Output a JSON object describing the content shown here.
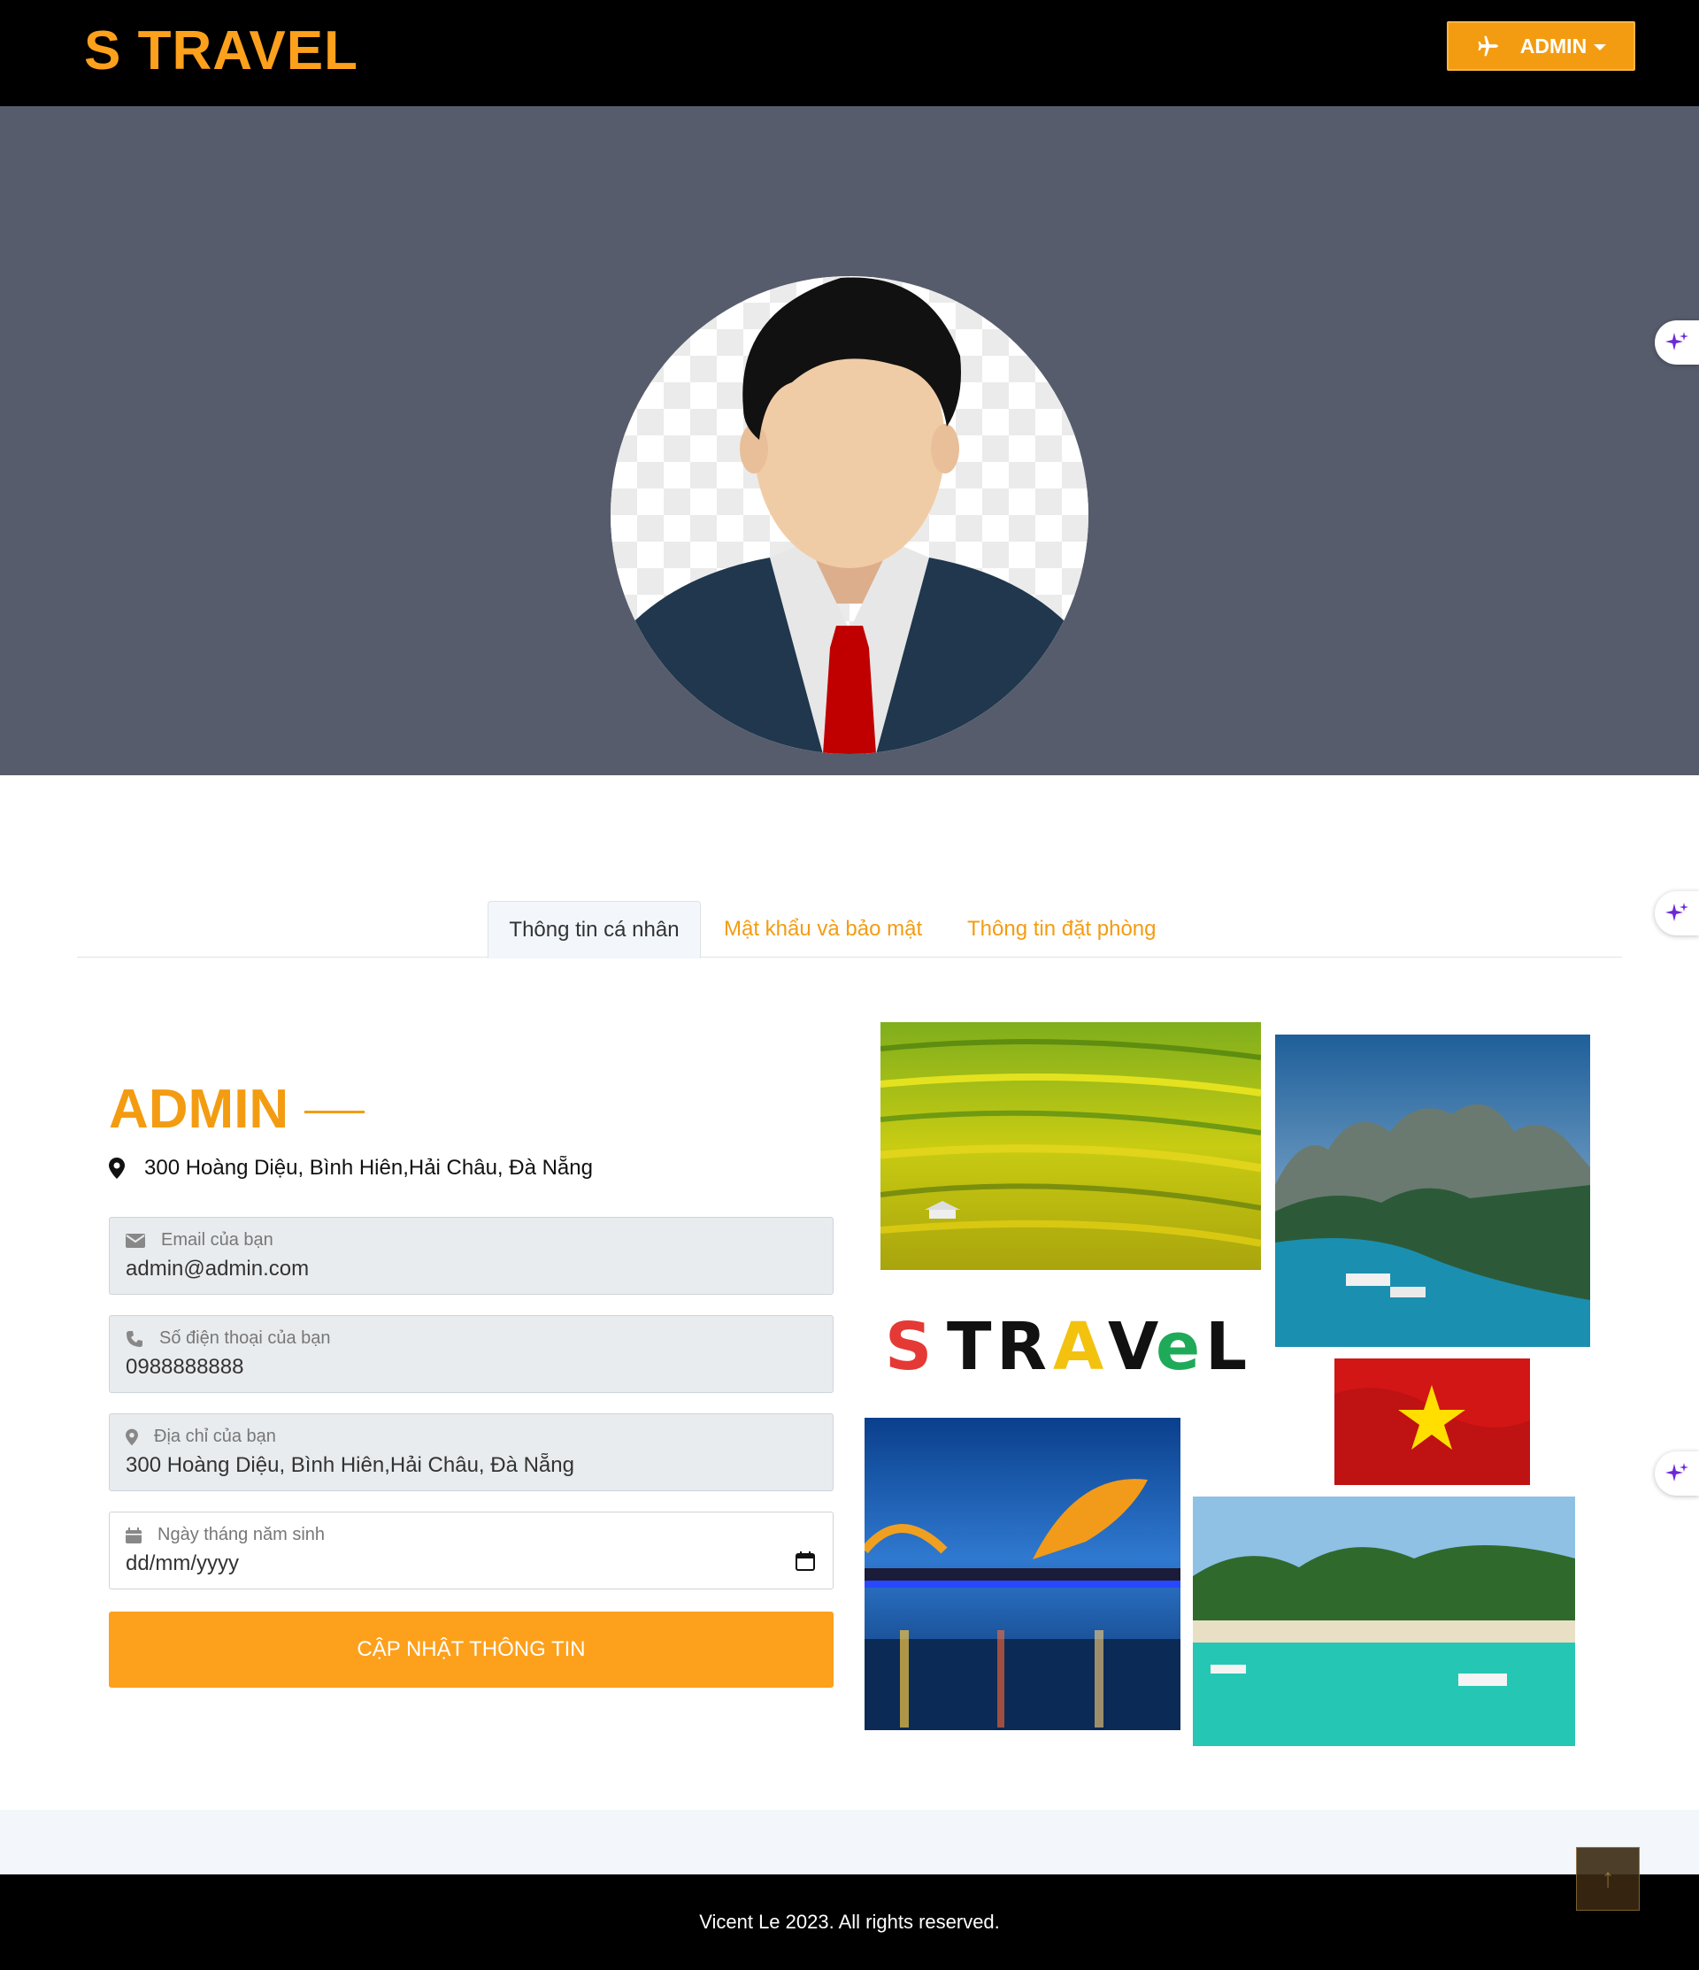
{
  "header": {
    "logo": "S TRAVEL",
    "user_button_label": "ADMIN",
    "user_button_icon": "plane-icon"
  },
  "colors": {
    "accent": "#f39c12",
    "header_bg": "#000000",
    "hero_bg": "#565c6c"
  },
  "tabs": [
    {
      "label": "Thông tin cá nhân",
      "active": true
    },
    {
      "label": "Mật khẩu và bảo mật",
      "active": false
    },
    {
      "label": "Thông tin đặt phòng",
      "active": false
    }
  ],
  "profile": {
    "name": "ADMIN",
    "address": "300 Hoàng Diệu, Bình Hiên,Hải Châu, Đà Nẵng"
  },
  "form": {
    "email": {
      "label": "Email của bạn",
      "value": "admin@admin.com"
    },
    "phone": {
      "label": "Số điện thoại của bạn",
      "value": "0988888888"
    },
    "address": {
      "label": "Địa chỉ của bạn",
      "value": "300 Hoàng Diệu, Bình Hiên,Hải Châu, Đà Nẵng"
    },
    "birthday": {
      "label": "Ngày tháng năm sinh",
      "value": "dd/mm/yyyy"
    },
    "submit_label": "CẬP NHẬT THÔNG TIN"
  },
  "collage": {
    "logo_text": "STRAVEL"
  },
  "footer": {
    "copyright": "Vicent Le 2023. All rights reserved.",
    "back_to_top": "↑"
  }
}
